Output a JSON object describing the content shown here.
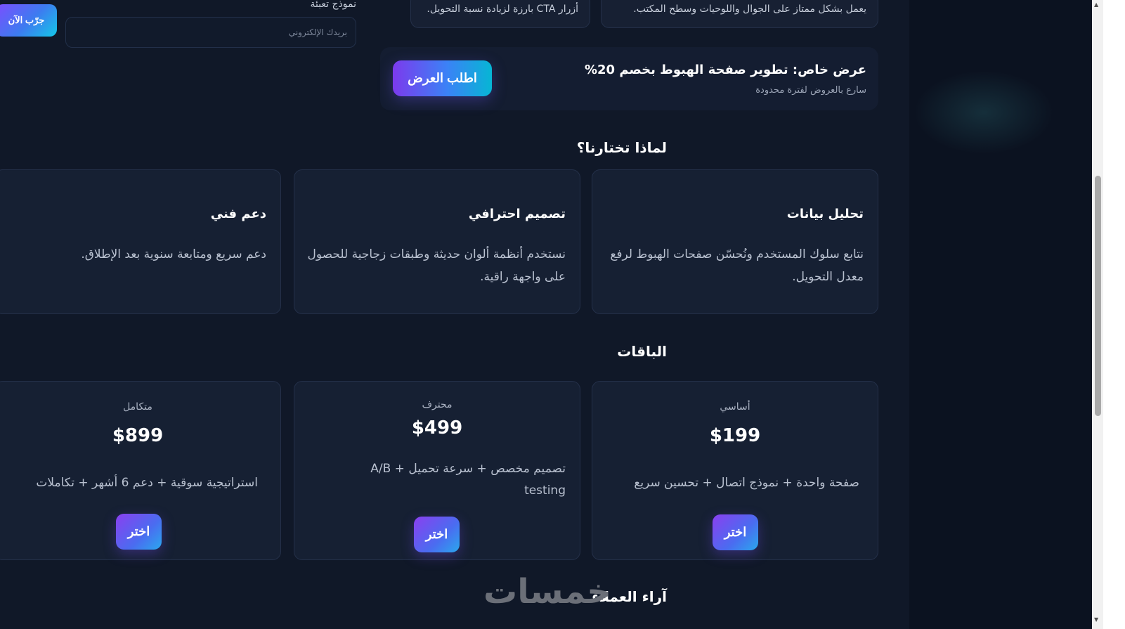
{
  "top": {
    "form_label": "نموذج تعبئة",
    "email_placeholder": "بريدك الإلكتروني",
    "try_button": "جرّب الآن",
    "card_responsive": "يعمل بشكل ممتاز على الجوال واللوحيات وسطح المكتب.",
    "card_cta": "أزرار CTA بارزة لزيادة نسبة التحويل."
  },
  "offer": {
    "title": "عرض خاص: تطوير صفحة الهبوط بخصم 20%",
    "subtitle": "سارع بالعروض لفترة محدودة",
    "button": "اطلب العرض"
  },
  "why": {
    "heading": "لماذا تختارنا؟",
    "cards": [
      {
        "title": "تحليل بيانات",
        "text": "نتابع سلوك المستخدم ونُحسّن صفحات الهبوط لرفع معدل التحويل."
      },
      {
        "title": "تصميم احترافي",
        "text": "نستخدم أنظمة ألوان حديثة وطبقات زجاجية للحصول على واجهة راقية."
      },
      {
        "title": "دعم فني",
        "text": "دعم سريع ومتابعة سنوية بعد الإطلاق."
      }
    ]
  },
  "plans": {
    "heading": "الباقات",
    "items": [
      {
        "name": "أساسي",
        "price": "$199",
        "desc": "صفحة واحدة + نموذج اتصال + تحسين سريع",
        "button": "اختر"
      },
      {
        "name": "محترف",
        "price": "$499",
        "desc": "تصميم مخصص + سرعة تحميل + A/B testing",
        "button": "اختر"
      },
      {
        "name": "متكامل",
        "price": "$899",
        "desc": "استراتيجية سوقية + دعم 6 أشهر + تكاملات",
        "button": "اختر"
      }
    ]
  },
  "testimonials": {
    "heading": "آراء العملاء"
  },
  "watermark": {
    "text": "خمسات"
  }
}
